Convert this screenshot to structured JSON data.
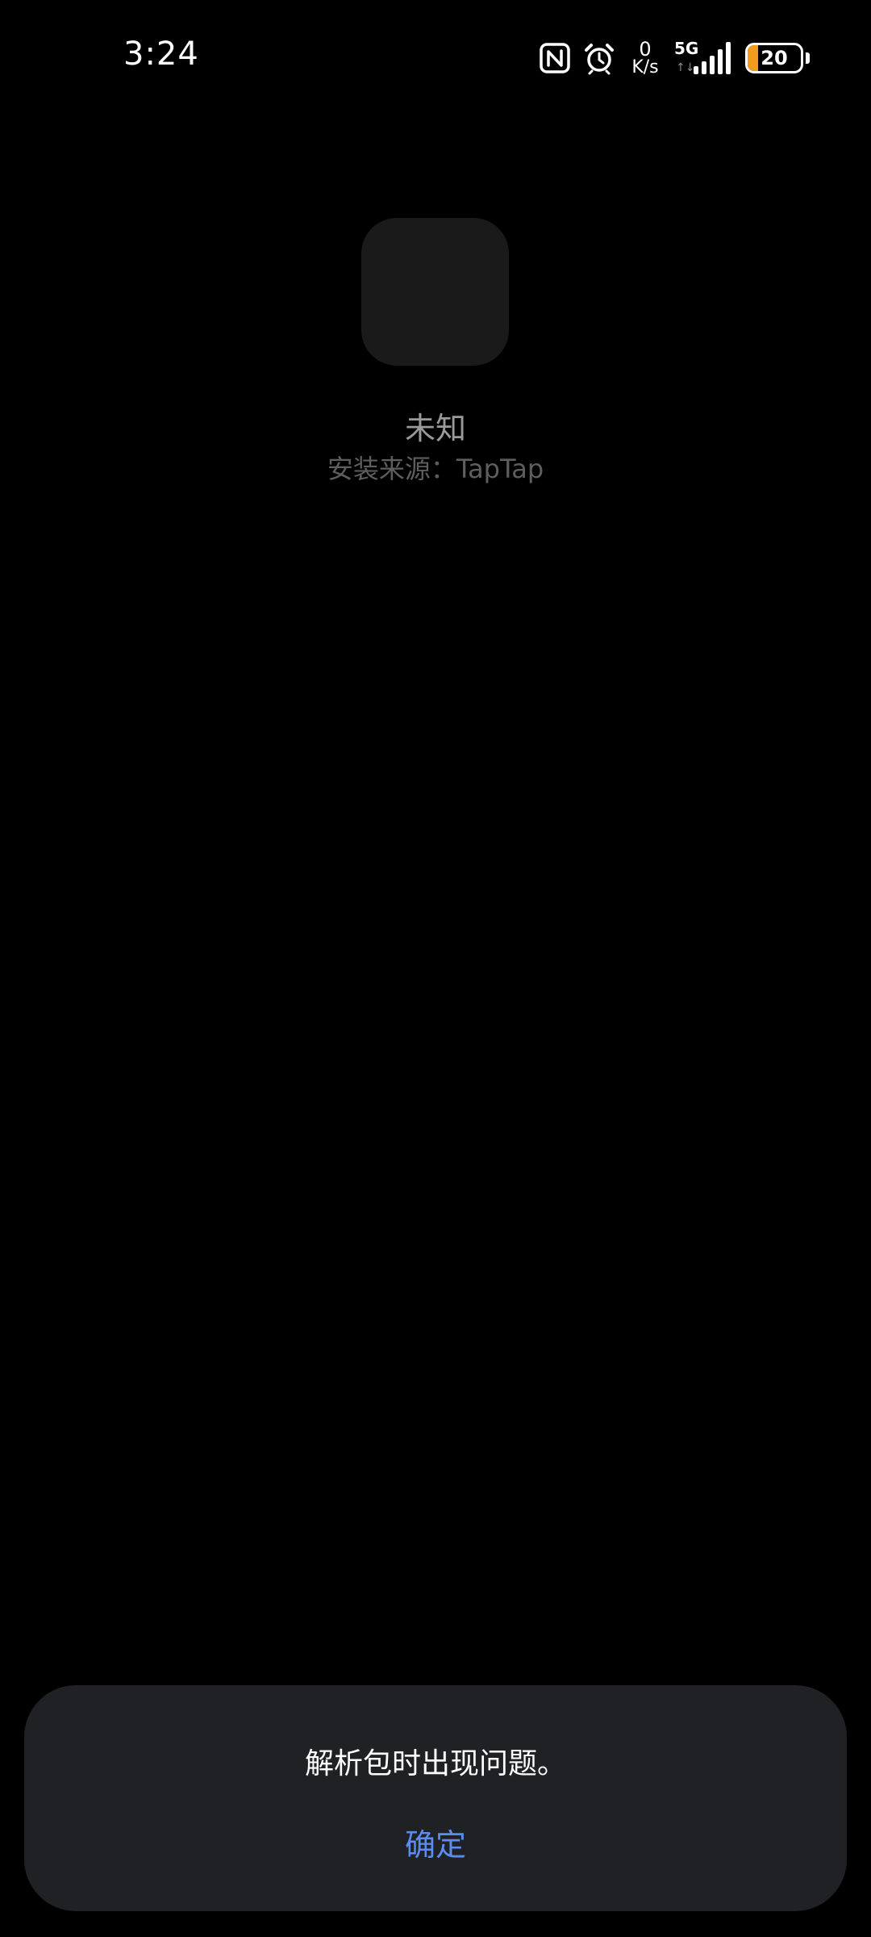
{
  "status_bar": {
    "time": "3:24",
    "net_speed_value": "0",
    "net_speed_unit": "K/s",
    "network_type": "5G",
    "network_arrows": "↑↓",
    "battery_level": "20",
    "battery_fraction": 0.2,
    "icons": [
      "nfc-icon",
      "alarm-icon",
      "signal-icon",
      "battery-icon"
    ]
  },
  "app": {
    "name": "未知",
    "install_source": "安装来源：TapTap"
  },
  "dialog": {
    "message": "解析包时出现问题。",
    "confirm_label": "确定"
  },
  "colors": {
    "background": "#000000",
    "icon_placeholder": "#1a1a1a",
    "dialog_background": "#202124",
    "accent": "#5b8def",
    "battery_fill": "#f29b1c"
  }
}
